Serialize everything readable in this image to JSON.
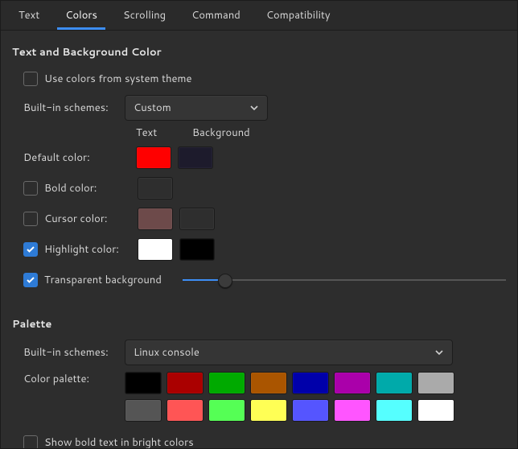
{
  "tabs": [
    "Text",
    "Colors",
    "Scrolling",
    "Command",
    "Compatibility"
  ],
  "activeTab": 1,
  "section1": {
    "title": "Text and Background Color",
    "useSystem": {
      "label": "Use colors from system theme",
      "checked": false
    },
    "schemeLabel": "Built-in schemes:",
    "schemeValue": "Custom",
    "headers": {
      "text": "Text",
      "bg": "Background"
    },
    "rows": {
      "default": {
        "label": "Default color:",
        "text": "#ff0000",
        "bg": "#1d1b2c"
      },
      "bold": {
        "label": "Bold color:",
        "checked": false,
        "text": "#2e2e2e"
      },
      "cursor": {
        "label": "Cursor color:",
        "checked": false,
        "text": "#6d4a4a",
        "bg": "#2e2e2e"
      },
      "highlight": {
        "label": "Highlight color:",
        "checked": true,
        "text": "#ffffff",
        "bg": "#000000"
      }
    },
    "transparent": {
      "label": "Transparent background",
      "checked": true,
      "value": 13
    }
  },
  "section2": {
    "title": "Palette",
    "schemeLabel": "Built-in schemes:",
    "schemeValue": "Linux console",
    "paletteLabel": "Color palette:",
    "palette": [
      "#000000",
      "#aa0000",
      "#00aa00",
      "#aa5500",
      "#0000aa",
      "#aa00aa",
      "#00aaaa",
      "#aaaaaa",
      "#555555",
      "#ff5555",
      "#55ff55",
      "#ffff55",
      "#5555ff",
      "#ff55ff",
      "#55ffff",
      "#ffffff"
    ],
    "showBold": {
      "label": "Show bold text in bright colors",
      "checked": false
    }
  }
}
